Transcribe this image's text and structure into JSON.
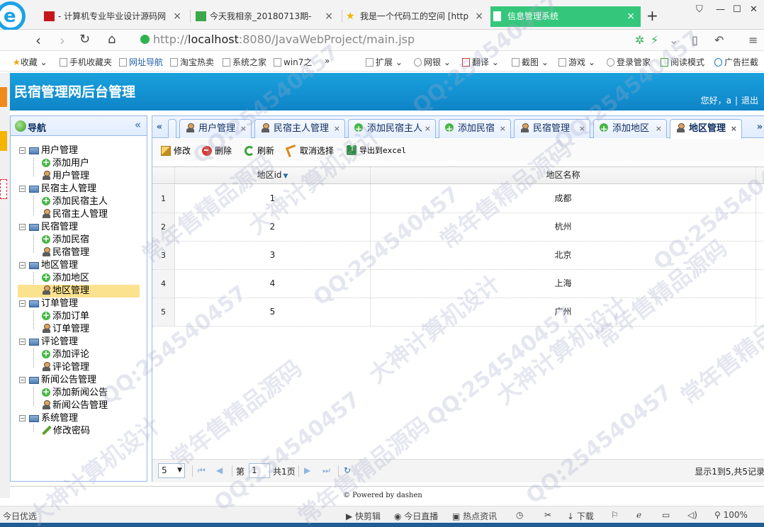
{
  "browser": {
    "logo_letter": "e",
    "tabs": [
      {
        "label": "- 计算机专业毕业设计源码网",
        "icon": "red-square-icon"
      },
      {
        "label": "今天我相亲_20180713期-",
        "icon": "video-icon"
      },
      {
        "label": "我是一个代码工的空间 [http",
        "icon": "star-icon"
      },
      {
        "label": "信息管理系统",
        "icon": "page-icon"
      }
    ],
    "tab_close": "×",
    "new_tab": "+",
    "url_host": "http://",
    "url_bold": "localhost",
    "url_rest": ":8080/JavaWebProject/main.jsp",
    "bookmarks": [
      "收藏",
      "手机收藏夹",
      "网址导航",
      "淘宝热卖",
      "系统之家",
      "win7之",
      "»",
      "扩展",
      "网银",
      "翻译",
      "截图",
      "游戏",
      "登录管家",
      "阅读模式",
      "广告拦截"
    ]
  },
  "app": {
    "title": "民宿管理网后台管理",
    "greeting": "您好，a",
    "separator": "|",
    "logout": "退出",
    "footer": "© Powered by dashen"
  },
  "nav": {
    "title": "导航",
    "collapse": "«",
    "groups": [
      {
        "label": "用户管理",
        "items": [
          {
            "label": "添加用户",
            "icon": "add"
          },
          {
            "label": "用户管理",
            "icon": "user"
          }
        ]
      },
      {
        "label": "民宿主人管理",
        "items": [
          {
            "label": "添加民宿主人",
            "icon": "add"
          },
          {
            "label": "民宿主人管理",
            "icon": "user"
          }
        ]
      },
      {
        "label": "民宿管理",
        "items": [
          {
            "label": "添加民宿",
            "icon": "add"
          },
          {
            "label": "民宿管理",
            "icon": "user"
          }
        ]
      },
      {
        "label": "地区管理",
        "items": [
          {
            "label": "添加地区",
            "icon": "add"
          },
          {
            "label": "地区管理",
            "icon": "user",
            "selected": true
          }
        ]
      },
      {
        "label": "订单管理",
        "items": [
          {
            "label": "添加订单",
            "icon": "add"
          },
          {
            "label": "订单管理",
            "icon": "user"
          }
        ]
      },
      {
        "label": "评论管理",
        "items": [
          {
            "label": "添加评论",
            "icon": "add"
          },
          {
            "label": "评论管理",
            "icon": "user"
          }
        ]
      },
      {
        "label": "新闻公告管理",
        "items": [
          {
            "label": "添加新闻公告",
            "icon": "add"
          },
          {
            "label": "新闻公告管理",
            "icon": "user"
          }
        ]
      },
      {
        "label": "系统管理",
        "items": [
          {
            "label": "修改密码",
            "icon": "pencil"
          }
        ]
      }
    ]
  },
  "tabs": {
    "scroll_left": "«",
    "scroll_right": "»",
    "items": [
      {
        "label": "用户管理",
        "icon": "user"
      },
      {
        "label": "民宿主人管理",
        "icon": "user"
      },
      {
        "label": "添加民宿主人",
        "icon": "add"
      },
      {
        "label": "添加民宿",
        "icon": "add"
      },
      {
        "label": "民宿管理",
        "icon": "user"
      },
      {
        "label": "添加地区",
        "icon": "add"
      },
      {
        "label": "地区管理",
        "icon": "user",
        "active": true
      }
    ],
    "close": "×"
  },
  "toolbar": {
    "edit": "修改",
    "delete": "删除",
    "refresh": "刷新",
    "cancel_select": "取消选择",
    "export": "导出到excel"
  },
  "grid": {
    "columns": [
      "地区id",
      "地区名称"
    ],
    "sort_indicator": "▼",
    "rows": [
      {
        "num": "1",
        "id": "1",
        "name": "成都"
      },
      {
        "num": "2",
        "id": "2",
        "name": "杭州"
      },
      {
        "num": "3",
        "id": "3",
        "name": "北京"
      },
      {
        "num": "4",
        "id": "4",
        "name": "上海"
      },
      {
        "num": "5",
        "id": "5",
        "name": "广州"
      }
    ]
  },
  "pager": {
    "page_size": "5",
    "page_prefix": "第",
    "page_value": "1",
    "page_suffix": "共1页",
    "info": "显示1到5,共5记录"
  },
  "statusbar": {
    "left": "今日优选",
    "items": [
      "快剪辑",
      "今日直播",
      "热点资讯",
      "下载",
      "100%"
    ]
  },
  "watermark": {
    "qq": "QQ:254540457",
    "text1": "常年售精品源码",
    "text2": "大神计算机设计"
  },
  "colors": {
    "header": "#0e84c6",
    "active_browser_tab": "#34c77b",
    "panel_border": "#95b8e7",
    "selected_node": "#fbe28f"
  }
}
